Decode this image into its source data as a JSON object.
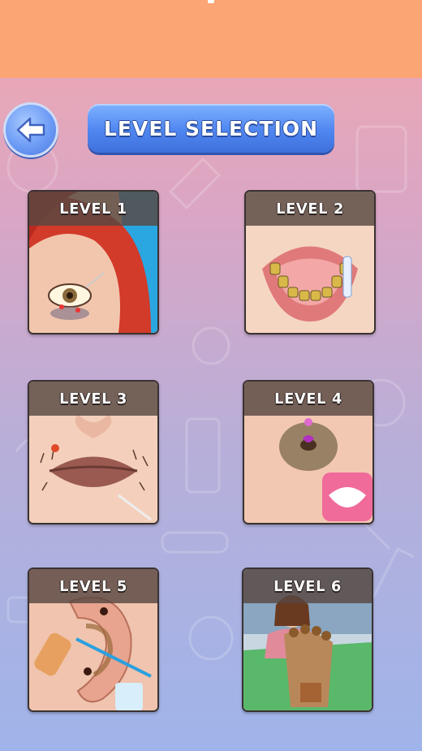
{
  "title": "LEVEL SELECTION",
  "back_button": {
    "icon": "arrow-left-icon"
  },
  "colors": {
    "top_bar": "#fca574",
    "title_button": "#4f86f0",
    "card_header": "#584842"
  },
  "levels": [
    {
      "label": "LEVEL 1",
      "theme": "eye-care"
    },
    {
      "label": "LEVEL 2",
      "theme": "dental"
    },
    {
      "label": "LEVEL 3",
      "theme": "lips"
    },
    {
      "label": "LEVEL 4",
      "theme": "belly-button"
    },
    {
      "label": "LEVEL 5",
      "theme": "ear-cleaning"
    },
    {
      "label": "LEVEL 6",
      "theme": "foot-care"
    }
  ]
}
